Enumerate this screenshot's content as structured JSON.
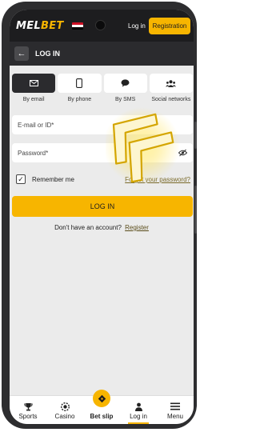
{
  "header": {
    "logo_part1": "MEL",
    "logo_part2": "BET",
    "flag_colors": [
      "#ce1126",
      "#ffffff",
      "#000000"
    ],
    "login_label": "Log in",
    "register_label": "Registration"
  },
  "subbar": {
    "title": "LOG IN",
    "back_icon": "arrow-left"
  },
  "tabs": [
    {
      "label": "By email",
      "icon": "envelope-icon",
      "active": true
    },
    {
      "label": "By phone",
      "icon": "phone-icon",
      "active": false
    },
    {
      "label": "By SMS",
      "icon": "chat-bubble-icon",
      "active": false
    },
    {
      "label": "Social networks",
      "icon": "people-icon",
      "active": false
    }
  ],
  "form": {
    "email_placeholder": "E-mail or ID*",
    "password_placeholder": "Password*",
    "remember_label": "Remember me",
    "remember_checked": true,
    "forgot_label": "Forgot your password?",
    "login_button": "LOG IN",
    "no_account_text": "Don't have an account?",
    "register_link": "Register"
  },
  "bottom_nav": [
    {
      "label": "Sports",
      "icon": "trophy-icon"
    },
    {
      "label": "Casino",
      "icon": "chip-icon"
    },
    {
      "label": "Bet slip",
      "icon": "ticket-icon"
    },
    {
      "label": "Log in",
      "icon": "person-icon",
      "active": true
    },
    {
      "label": "Menu",
      "icon": "hamburger-icon"
    }
  ],
  "colors": {
    "accent": "#f7b500",
    "header_bg": "#1d1d1f",
    "screen_bg": "#ebebeb"
  }
}
